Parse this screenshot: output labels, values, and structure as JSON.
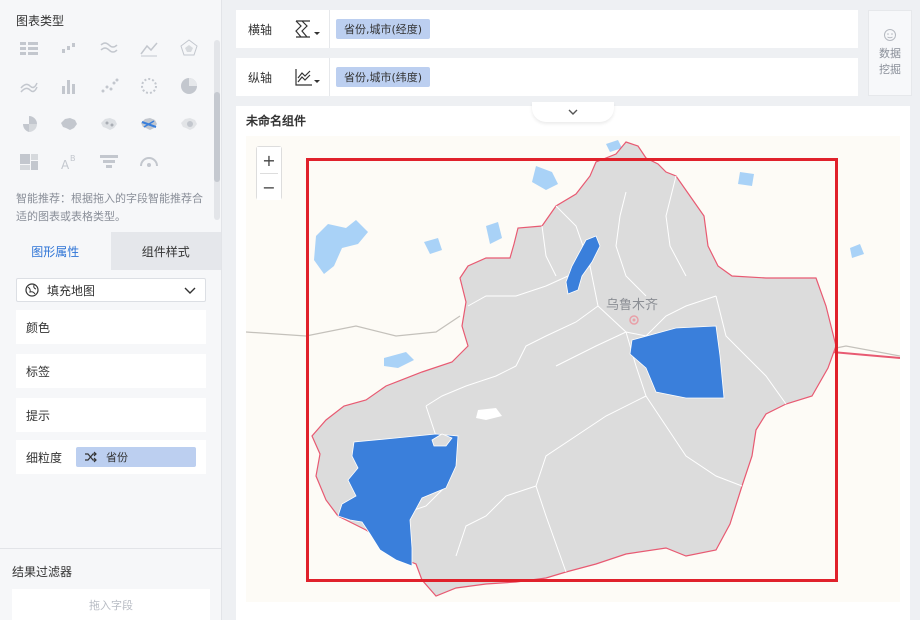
{
  "left_panel": {
    "chart_types_title": "图表类型",
    "smart_tip": "智能推荐：根据拖入的字段智能推荐合适的图表或表格类型。",
    "tabs": {
      "graph_props": "图形属性",
      "component_style": "组件样式"
    },
    "map_type": {
      "selected": "填充地图"
    },
    "props": {
      "color": "颜色",
      "label": "标签",
      "tooltip": "提示",
      "granularity": "细粒度"
    },
    "granularity_value": "省份",
    "filter": {
      "title": "结果过滤器",
      "placeholder": "拖入字段"
    }
  },
  "axes": {
    "x": {
      "label": "横轴",
      "field": "省份,城市(经度)"
    },
    "y": {
      "label": "纵轴",
      "field": "省份,城市(纬度)"
    }
  },
  "data_mining": {
    "line1": "数据",
    "line2": "挖掘"
  },
  "widget": {
    "title": "未命名组件"
  },
  "map": {
    "zoom_in": "+",
    "zoom_out": "−",
    "city_label": "乌鲁木齐",
    "colors": {
      "region": "#dcdcdc",
      "highlight": "#3a7fdb",
      "water": "#a9d2f7",
      "border": "#e85a72",
      "select": "#e0212b"
    }
  }
}
